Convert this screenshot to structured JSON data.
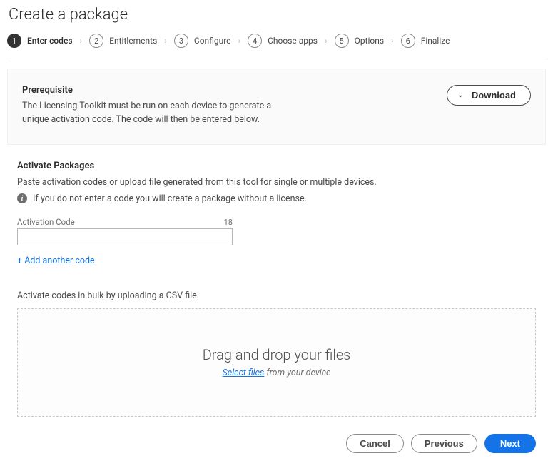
{
  "title": "Create a package",
  "steps": [
    {
      "num": "1",
      "label": "Enter codes",
      "active": true
    },
    {
      "num": "2",
      "label": "Entitlements",
      "active": false
    },
    {
      "num": "3",
      "label": "Configure",
      "active": false
    },
    {
      "num": "4",
      "label": "Choose apps",
      "active": false
    },
    {
      "num": "5",
      "label": "Options",
      "active": false
    },
    {
      "num": "6",
      "label": "Finalize",
      "active": false
    }
  ],
  "prereq": {
    "title": "Prerequisite",
    "text": "The Licensing Toolkit must be run on each device to generate a unique activation code. The code will then be entered below.",
    "download_label": "Download"
  },
  "activate": {
    "title": "Activate Packages",
    "subtitle": "Paste activation codes or upload file generated from this tool for single or multiple devices.",
    "info_text": "If you do not enter a code you will create a package without a license.",
    "field_label": "Activation Code",
    "field_counter": "18",
    "field_value": "",
    "add_link": "+ Add another code",
    "bulk_label": "Activate codes in bulk by uploading a CSV file.",
    "dropzone_title": "Drag and drop your files",
    "dropzone_select": "Select files",
    "dropzone_suffix": " from your device"
  },
  "footer": {
    "cancel": "Cancel",
    "previous": "Previous",
    "next": "Next"
  }
}
